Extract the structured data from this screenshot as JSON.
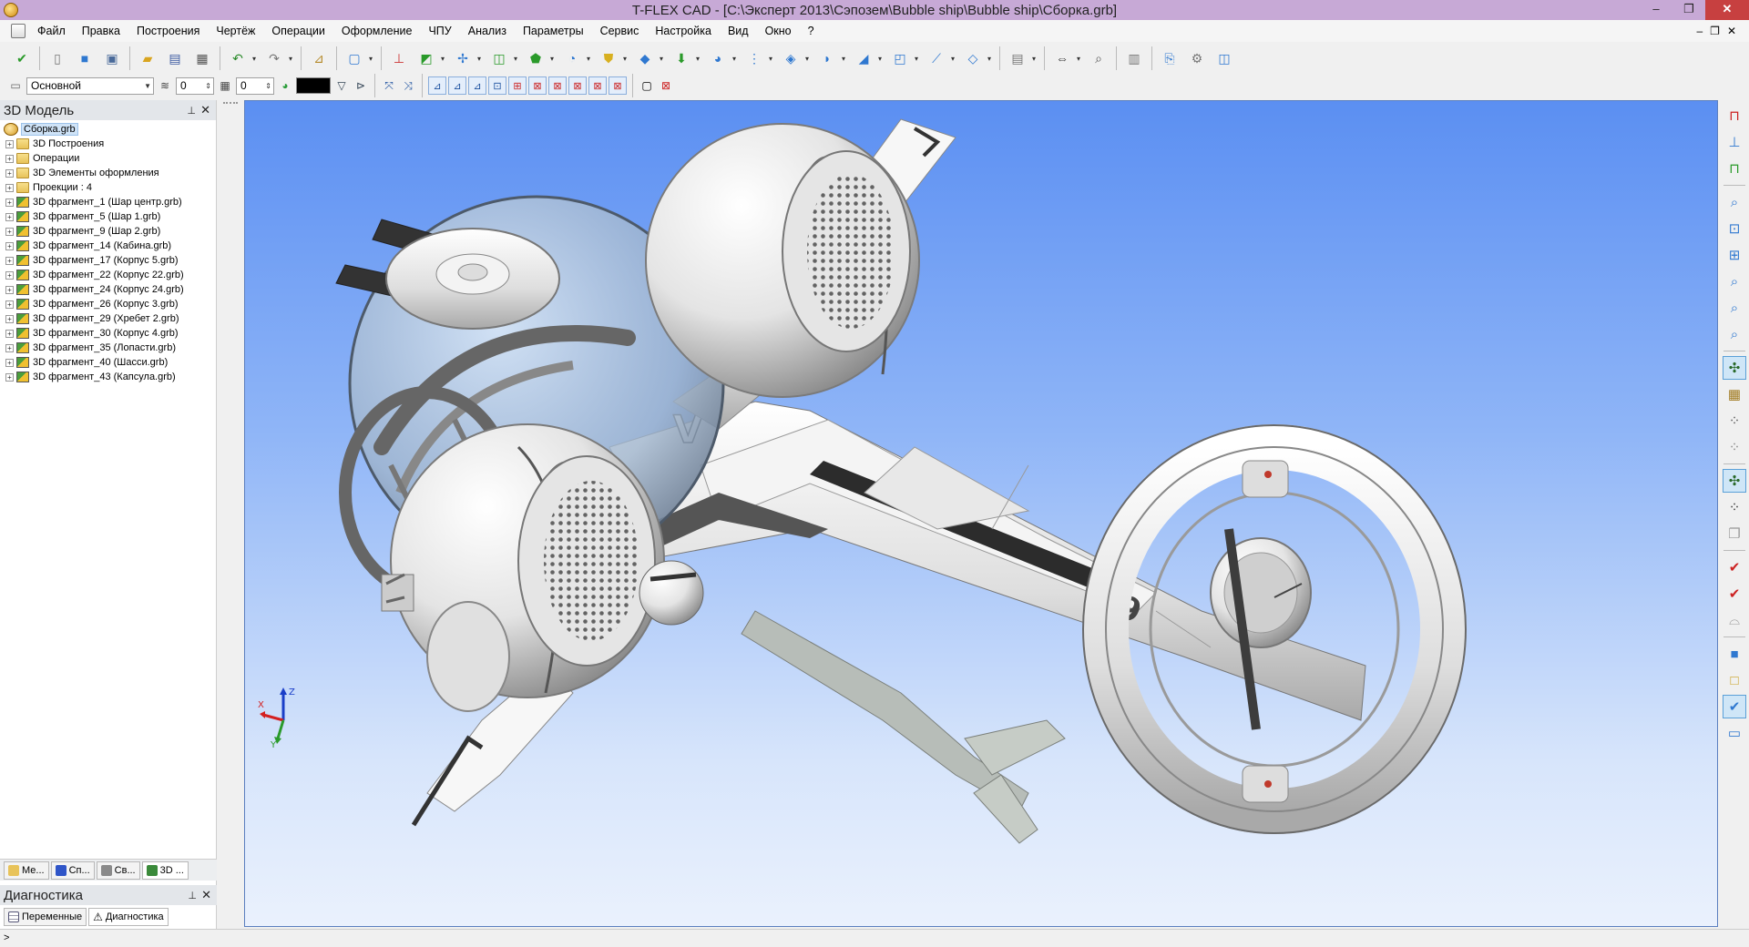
{
  "window": {
    "title": "T-FLEX CAD - [C:\\Эксперт 2013\\Сэпозем\\Bubble ship\\Bubble ship\\Сборка.grb]",
    "minimize": "‒",
    "restore": "❐",
    "close": "✕"
  },
  "menu": {
    "items": [
      "Файл",
      "Правка",
      "Построения",
      "Чертёж",
      "Операции",
      "Оформление",
      "ЧПУ",
      "Анализ",
      "Параметры",
      "Сервис",
      "Настройка",
      "Вид",
      "Окно",
      "?"
    ],
    "mdi": {
      "minimize": "‒",
      "restore": "❐",
      "close": "✕"
    }
  },
  "toolbar2": {
    "layer": "Основной",
    "level_value": "0",
    "priority_value": "0",
    "line_color": "#000000"
  },
  "left_panel": {
    "title": "3D Модель",
    "tree": [
      {
        "label": "Сборка.grb",
        "type": "root"
      },
      {
        "label": "3D Построения",
        "type": "folder"
      },
      {
        "label": "Операции",
        "type": "folder"
      },
      {
        "label": "3D Элементы оформления",
        "type": "folder"
      },
      {
        "label": "Проекции : 4",
        "type": "folder"
      },
      {
        "label": "3D фрагмент_1 (Шар центр.grb)",
        "type": "fragment"
      },
      {
        "label": "3D фрагмент_5 (Шар 1.grb)",
        "type": "fragment"
      },
      {
        "label": "3D фрагмент_9 (Шар 2.grb)",
        "type": "fragment"
      },
      {
        "label": "3D фрагмент_14 (Кабина.grb)",
        "type": "fragment"
      },
      {
        "label": "3D фрагмент_17 (Корпус 5.grb)",
        "type": "fragment"
      },
      {
        "label": "3D фрагмент_22 (Корпус 22.grb)",
        "type": "fragment"
      },
      {
        "label": "3D фрагмент_24 (Корпус 24.grb)",
        "type": "fragment"
      },
      {
        "label": "3D фрагмент_26 (Корпус 3.grb)",
        "type": "fragment"
      },
      {
        "label": "3D фрагмент_29 (Хребет 2.grb)",
        "type": "fragment"
      },
      {
        "label": "3D фрагмент_30 (Корпус 4.grb)",
        "type": "fragment"
      },
      {
        "label": "3D фрагмент_35 (Лопасти.grb)",
        "type": "fragment"
      },
      {
        "label": "3D фрагмент_40 (Шасси.grb)",
        "type": "fragment"
      },
      {
        "label": "3D фрагмент_43 (Капсула.grb)",
        "type": "fragment"
      }
    ],
    "tabs": [
      "Ме...",
      "Сп...",
      "Св...",
      "3D ..."
    ]
  },
  "diagnostics": {
    "title": "Диагностика",
    "tabs": [
      "Переменные",
      "Диагностика"
    ]
  },
  "axes": {
    "x": "X",
    "y": "Y",
    "z": "Z"
  },
  "status": {
    "text": ">"
  },
  "icons": {
    "toolbar1": [
      "check-green-icon",
      "new-doc-icon",
      "cube-blue-icon",
      "window-icon",
      "open-folder-icon",
      "save-icon",
      "print-icon",
      "undo-icon",
      "redo-icon",
      "measure-icon",
      "box-icon",
      "axis-icon",
      "sketch-icon",
      "lcs-icon",
      "plane-icon",
      "extrude-icon",
      "rotate-icon",
      "shield-icon",
      "loft-icon",
      "arrow-down-icon",
      "sweep-icon",
      "array-icon",
      "boolean-icon",
      "fillet-icon",
      "chamfer-icon",
      "shell-icon",
      "pipe-icon",
      "surface-icon",
      "view-icon",
      "scale-5-icon",
      "zoom-icon",
      "calc-icon",
      "paperclip-icon",
      "gear-icon",
      "frame-icon"
    ],
    "right": [
      "magnet-icon",
      "ruler-icon",
      "magnet-alt-icon",
      "zoom-window-icon",
      "zoom-all-icon",
      "zoom-fit-icon",
      "zoom-in-icon",
      "zoom-out-icon",
      "zoom-prev-icon",
      "snap-icon",
      "grid-icon",
      "balls-icon",
      "balls-alt-icon",
      "pin-icon",
      "cluster-icon",
      "copy-icon",
      "check-red-icon",
      "check-red-alt-icon",
      "sketch-alt-icon",
      "cube-shade-icon",
      "cube-wire-icon",
      "cube-check-icon",
      "frame-alt-icon"
    ]
  }
}
